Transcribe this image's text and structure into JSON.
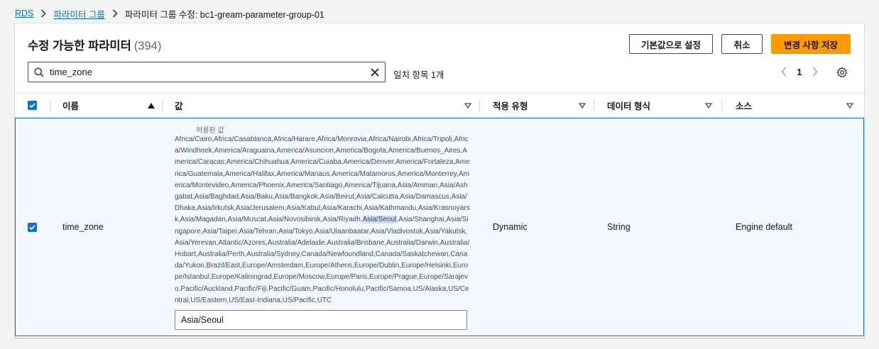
{
  "breadcrumb": {
    "root": "RDS",
    "parent": "파라미터 그룹",
    "current": "파라미터 그룹 수정: bc1-gream-parameter-group-01"
  },
  "header": {
    "title": "수정 가능한 파라미터",
    "count": "(394)"
  },
  "actions": {
    "reset_label": "기본값으로 설정",
    "cancel_label": "취소",
    "save_label": "변경 사항 저장"
  },
  "search": {
    "value": "time_zone",
    "match_text": "일치 항목 1개"
  },
  "pagination": {
    "current_page": "1"
  },
  "table": {
    "columns": {
      "name": "이름",
      "value": "값",
      "apply_type": "적용 유형",
      "data_type": "데이터 형식",
      "source": "소스"
    },
    "row": {
      "name": "time_zone",
      "allowed_title": "허용된 값",
      "allowed_before": "Africa/Cairo,Africa/Casablanca,Africa/Harare,Africa/Monrovia,Africa/Nairobi,Africa/Tripoli,Africa/Windhoek,America/Araguaina,America/Asuncion,America/Bogota,America/Buenos_Aires,America/Caracas,America/Chihuahua,America/Cuiaba,America/Denver,America/Fortaleza,America/Guatemala,America/Halifax,America/Manaus,America/Matamoros,America/Monterrey,America/Montevideo,America/Phoenix,America/Santiago,America/Tijuana,Asia/Amman,Asia/Ashgabat,Asia/Baghdad,Asia/Baku,Asia/Bangkok,Asia/Beirut,Asia/Calcutta,Asia/Damascus,Asia/Dhaka,Asia/Irkutsk,Asia/Jerusalem,Asia/Kabul,Asia/Karachi,Asia/Kathmandu,Asia/Krasnoyarsk,Asia/Magadan,Asia/Muscat,Asia/Novosibirsk,Asia/Riyadh,",
      "allowed_highlight": "Asia/Seoul",
      "allowed_after": ",Asia/Shanghai,Asia/Singapore,Asia/Taipei,Asia/Tehran,Asia/Tokyo,Asia/Ulaanbaatar,Asia/Vladivostok,Asia/Yakutsk,Asia/Yerevan,Atlantic/Azores,Australia/Adelaide,Australia/Brisbane,Australia/Darwin,Australia/Hobart,Australia/Perth,Australia/Sydney,Canada/Newfoundland,Canada/Saskatchewan,Canada/Yukon,Brazil/East,Europe/Amsterdam,Europe/Athens,Europe/Dublin,Europe/Helsinki,Europe/Istanbul,Europe/Kaliningrad,Europe/Moscow,Europe/Paris,Europe/Prague,Europe/Sarajevo,Pacific/Auckland,Pacific/Fiji,Pacific/Guam,Pacific/Honolulu,Pacific/Samoa,US/Alaska,US/Central,US/Eastern,US/East-Indiana,US/Pacific,UTC",
      "value": "Asia/Seoul",
      "apply_type": "Dynamic",
      "data_type": "String",
      "source": "Engine default"
    }
  },
  "colors": {
    "primary": "#ff9900",
    "link": "#0972d3",
    "selected_row": "#f2f8fd"
  },
  "icons": [
    "chevron-right-icon",
    "search-icon",
    "close-icon",
    "chevron-left-icon",
    "settings-icon",
    "sort-up-icon",
    "sort-down-icon",
    "checkbox-checked-icon"
  ]
}
